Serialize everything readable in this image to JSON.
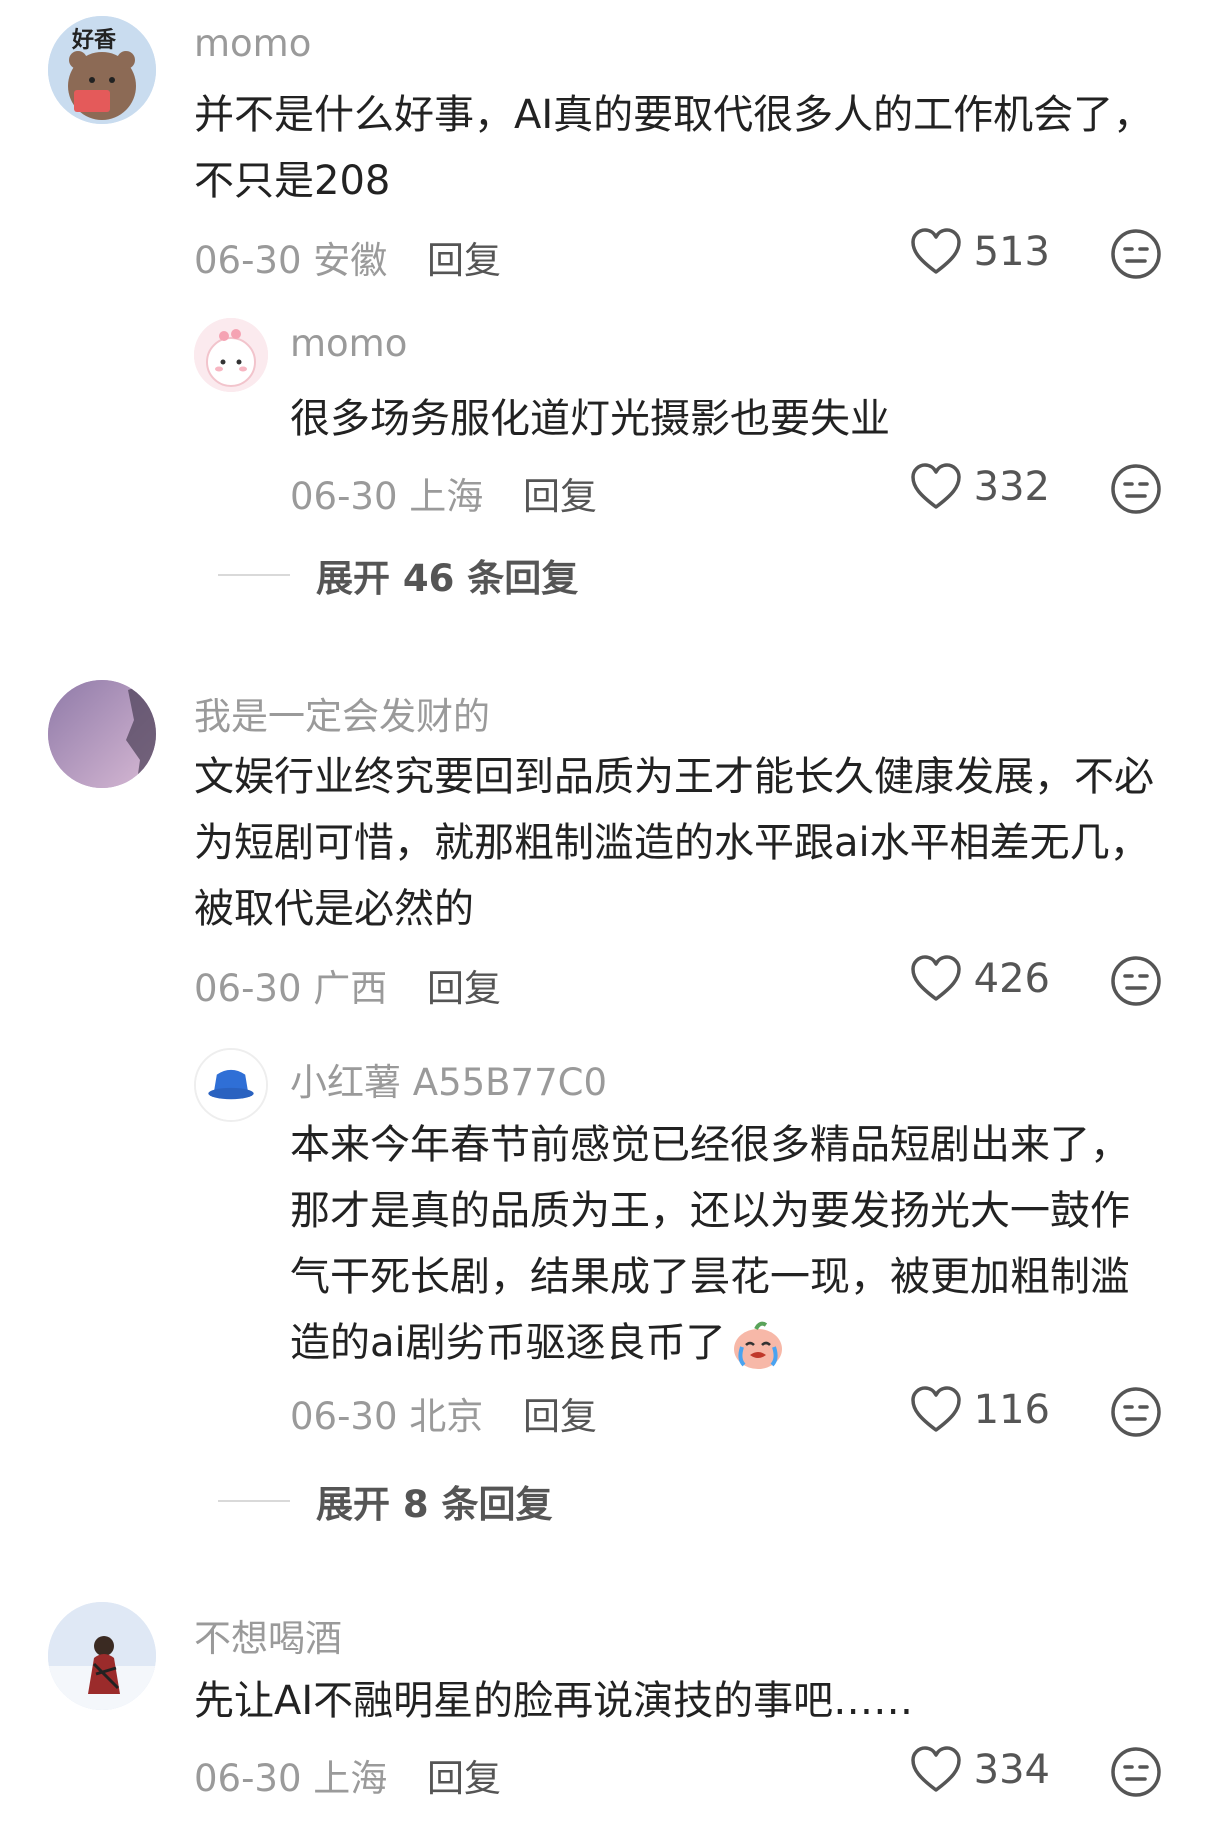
{
  "comments": [
    {
      "name": "momo",
      "text": "并不是什么好事，AI真的要取代很多人的工作机会了，不只是208",
      "date": "06-30",
      "location": "安徽",
      "reply_label": "回复",
      "likes": "513",
      "avatar_text": "好香",
      "reply": {
        "name": "momo",
        "text": "很多场务服化道灯光摄影也要失业",
        "date": "06-30",
        "location": "上海",
        "reply_label": "回复",
        "likes": "332"
      },
      "expand_label": "展开 46 条回复"
    },
    {
      "name": "我是一定会发财的",
      "text": "文娱行业终究要回到品质为王才能长久健康发展，不必为短剧可惜，就那粗制滥造的水平跟ai水平相差无几，被取代是必然的",
      "date": "06-30",
      "location": "广西",
      "reply_label": "回复",
      "likes": "426",
      "reply": {
        "name": "小红薯 A55B77C0",
        "text": "本来今年春节前感觉已经很多精品短剧出来了，那才是真的品质为王，还以为要发扬光大一鼓作气干死长剧，结果成了昙花一现，被更加粗制滥造的ai剧劣币驱逐良币了",
        "date": "06-30",
        "location": "北京",
        "reply_label": "回复",
        "likes": "116"
      },
      "expand_label": "展开 8 条回复"
    },
    {
      "name": "不想喝酒",
      "text": "先让AI不融明星的脸再说演技的事吧……",
      "date": "06-30",
      "location": "上海",
      "reply_label": "回复",
      "likes": "334"
    }
  ],
  "colors": {
    "secondary_text": "#9a9a9a",
    "primary_text": "#222222",
    "icon": "#555555"
  }
}
